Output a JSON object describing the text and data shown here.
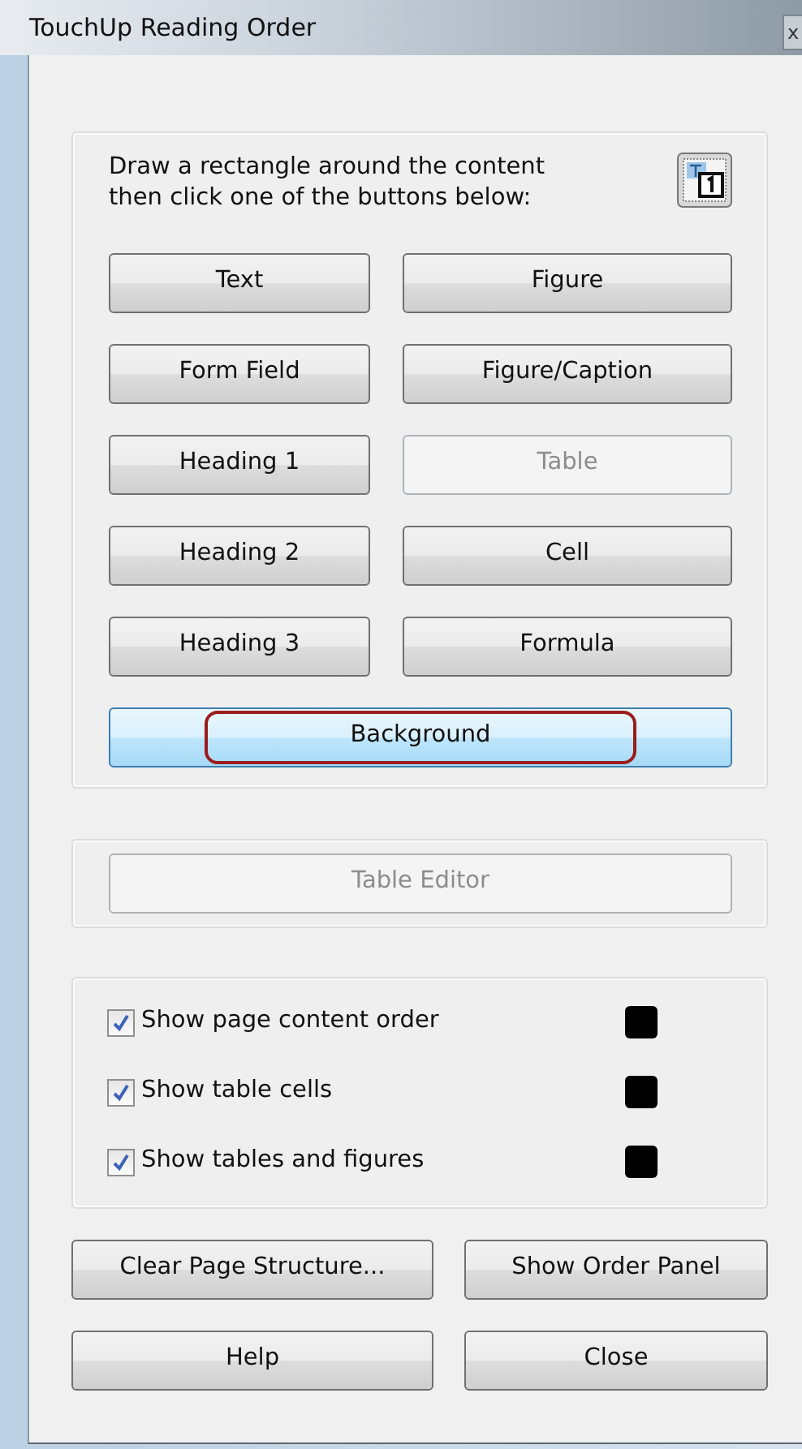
{
  "window": {
    "title": "TouchUp Reading Order",
    "close_glyph": "x"
  },
  "instructions": "Draw a rectangle around the content then click one of the buttons below:",
  "tag_buttons": [
    {
      "label": "Text",
      "disabled": false,
      "highlighted": false
    },
    {
      "label": "Figure",
      "disabled": false,
      "highlighted": false
    },
    {
      "label": "Form Field",
      "disabled": false,
      "highlighted": false
    },
    {
      "label": "Figure/Caption",
      "disabled": false,
      "highlighted": false
    },
    {
      "label": "Heading 1",
      "disabled": false,
      "highlighted": false
    },
    {
      "label": "Table",
      "disabled": true,
      "highlighted": false
    },
    {
      "label": "Heading 2",
      "disabled": false,
      "highlighted": false
    },
    {
      "label": "Cell",
      "disabled": false,
      "highlighted": false
    },
    {
      "label": "Heading 3",
      "disabled": false,
      "highlighted": false
    },
    {
      "label": "Formula",
      "disabled": false,
      "highlighted": false
    },
    {
      "label": "Background",
      "disabled": false,
      "highlighted": true
    }
  ],
  "table_editor": {
    "label": "Table Editor",
    "disabled": true
  },
  "options": [
    {
      "label": "Show page content order",
      "checked": true,
      "color": "#000000"
    },
    {
      "label": "Show table cells",
      "checked": true,
      "color": "#000000"
    },
    {
      "label": "Show tables and figures",
      "checked": true,
      "color": "#000000"
    }
  ],
  "buttons": [
    {
      "label": "Clear Page Structure..."
    },
    {
      "label": "Show Order Panel"
    },
    {
      "label": "Help"
    },
    {
      "label": "Close"
    }
  ]
}
